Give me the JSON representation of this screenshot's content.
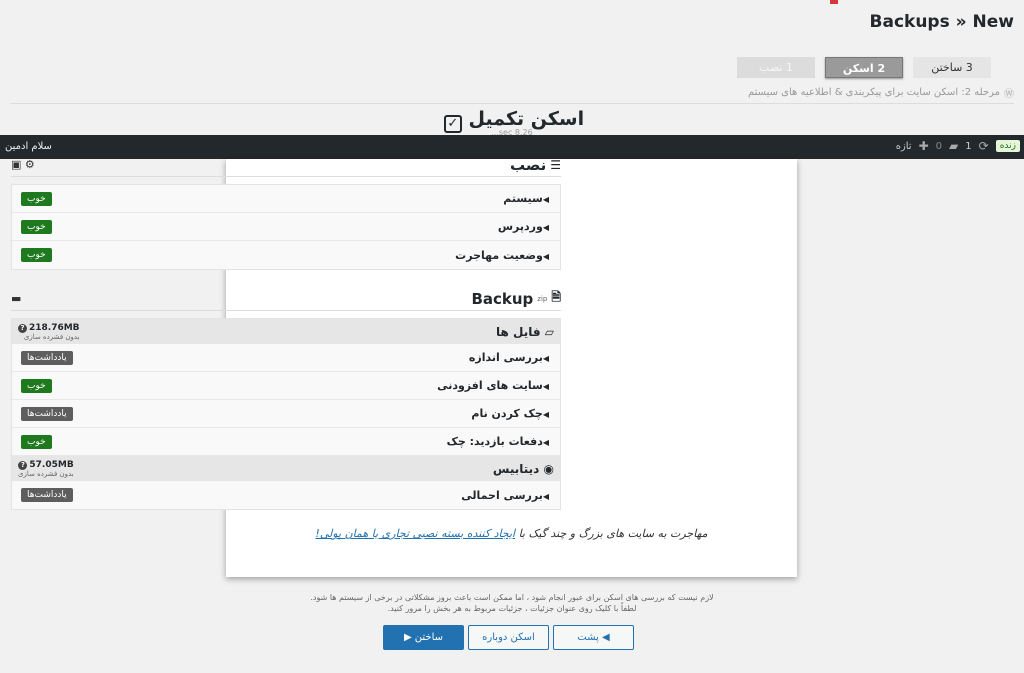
{
  "header": {
    "title": "Backups » New"
  },
  "steps": [
    {
      "label": "3 ساختن"
    },
    {
      "label": "2 اسکن"
    },
    {
      "label": "1 نصب"
    }
  ],
  "step_desc": "مرحله 2: اسکن سایت برای پیکربندی & اطلاعیه های سیستم",
  "scan": {
    "title": "اسکن تکمیل",
    "subtitle": "...sec 8.26"
  },
  "adminbar": {
    "user": "سلام ادمین",
    "live": "زنده",
    "updates_count": "1",
    "comments_count": "0",
    "new_label": "تازه"
  },
  "install_section": {
    "title": "نصب",
    "rows": [
      {
        "label": "سیستم",
        "status": "خوب"
      },
      {
        "label": "وردپرس",
        "status": "خوب"
      },
      {
        "label": "وضعیت مهاجرت",
        "status": "خوب"
      }
    ]
  },
  "backup_section": {
    "title": "Backup",
    "zip_tag": "zip",
    "files": {
      "name": "فایل ها",
      "size": "218.76MB",
      "size_note": "بدون فشرده سازی",
      "rows": [
        {
          "label": "بررسی اندازه",
          "status": "یادداشت‌ها",
          "kind": "warn"
        },
        {
          "label": "سایت های افزودنی",
          "status": "خوب",
          "kind": "good"
        },
        {
          "label": "چک کردن نام",
          "status": "یادداشت‌ها",
          "kind": "warn"
        },
        {
          "label": "دفعات بازدید: چک",
          "status": "خوب",
          "kind": "good"
        }
      ]
    },
    "database": {
      "name": "دیتابیس",
      "size": "57.05MB",
      "size_note": "بدون فشرده سازی",
      "rows": [
        {
          "label": "بررسی احمالی",
          "status": "یادداشت‌ها",
          "kind": "warn"
        }
      ]
    }
  },
  "migrate": {
    "text": "مهاجرت به سایت های بزرگ و چند گیک با",
    "link": "ایجاد کننده بسته نصبی تجاری یا همان پولی!"
  },
  "notes": {
    "line1": "لازم نیست که بررسی های اسکن برای عبور انجام شود ، اما ممکن است باعث بروز مشکلاتی در برخی از سیستم ها شود.",
    "line2": "لطفاً با کلیک روی عنوان جزئیات ، جزئیات مربوط به هر بخش را مرور کنید."
  },
  "buttons": {
    "build": "ساختن ▶",
    "rescan": "اسکن دوباره",
    "back": "◀ پشت"
  }
}
